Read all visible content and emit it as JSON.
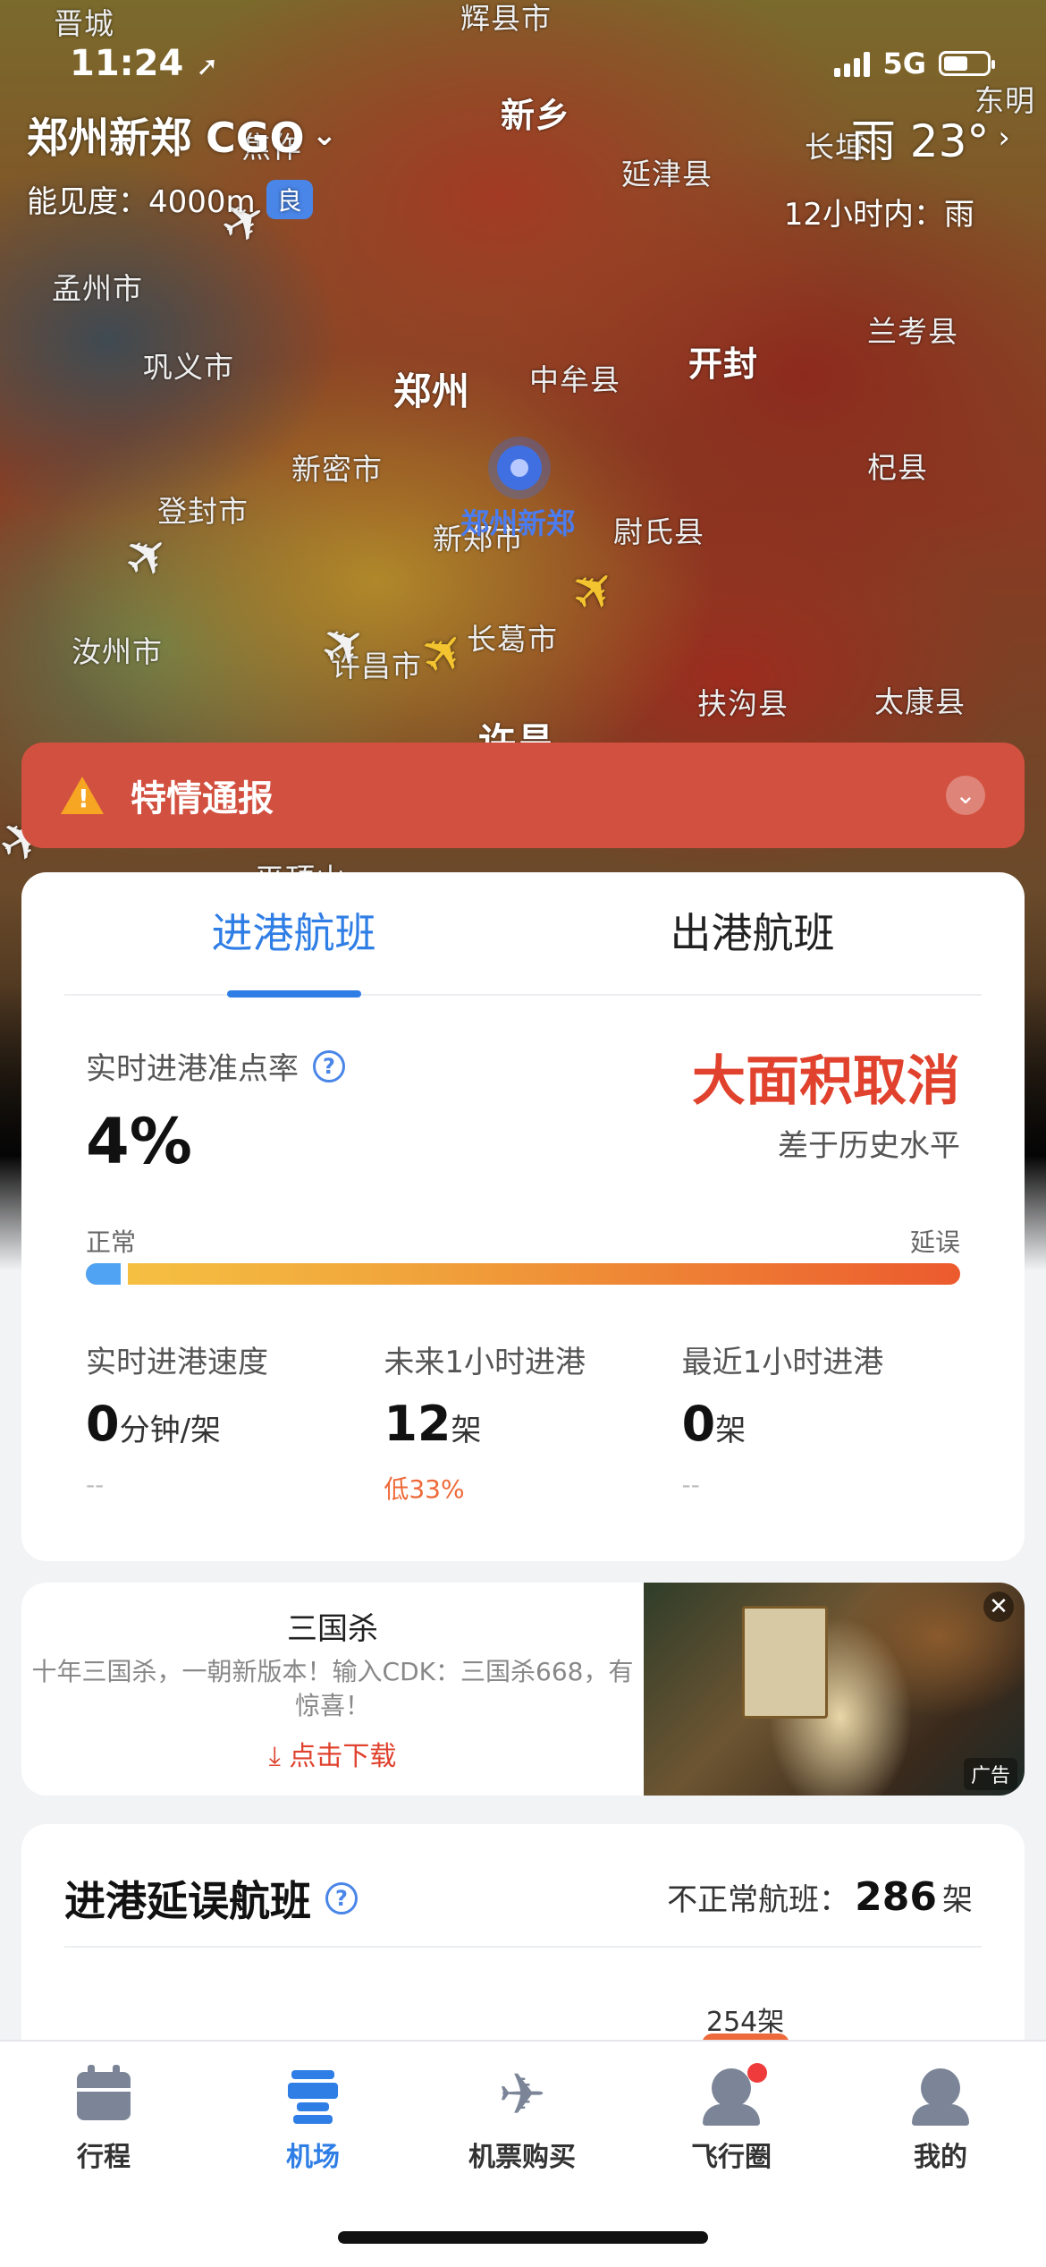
{
  "status_bar": {
    "time": "11:24",
    "network": "5G"
  },
  "header": {
    "airport": "郑州新郑 CGO",
    "visibility_label": "能见度：",
    "visibility_value": "4000m",
    "visibility_badge": "良",
    "weather": "雨 23°",
    "forecast": "12小时内：雨"
  },
  "map": {
    "cities": [
      "晋城",
      "辉县市",
      "新乡",
      "东明",
      "焦作",
      "延津县",
      "长垣",
      "孟州市",
      "巩义市",
      "郑州",
      "中牟县",
      "开封",
      "兰考县",
      "新密市",
      "登封市",
      "新郑市",
      "尉氏县",
      "杞县",
      "汝州市",
      "许昌市",
      "长葛市",
      "扶沟县",
      "太康县",
      "许昌",
      "平顶山"
    ],
    "airport_marker_label": "郑州新郑"
  },
  "alert": {
    "title": "特情通报"
  },
  "flights_card": {
    "tabs": [
      "进港航班",
      "出港航班"
    ],
    "active_tab": 0,
    "ontime_label": "实时进港准点率",
    "ontime_value": "4%",
    "status_text": "大面积取消",
    "history_compare": "差于历史水平",
    "bar_left_label": "正常",
    "bar_right_label": "延误",
    "ontime_fraction": 0.04,
    "stats": [
      {
        "label": "实时进港速度",
        "value": "0",
        "unit": "分钟/架",
        "sub": "--"
      },
      {
        "label": "未来1小时进港",
        "value": "12",
        "unit": "架",
        "sub": "低33%"
      },
      {
        "label": "最近1小时进港",
        "value": "0",
        "unit": "架",
        "sub": "--"
      }
    ]
  },
  "ad": {
    "title": "三国杀",
    "description": "十年三国杀，一朝新版本！输入CDK：三国杀668，有惊喜！",
    "cta": "点击下载",
    "tag": "广告"
  },
  "delay_section": {
    "title": "进港延误航班",
    "abnormal_label": "不正常航班：",
    "abnormal_count": "286",
    "abnormal_unit": "架",
    "bar_label": "254架"
  },
  "tabbar": [
    {
      "label": "行程",
      "icon": "calendar-icon"
    },
    {
      "label": "机场",
      "icon": "control-tower-icon"
    },
    {
      "label": "机票购买",
      "icon": "airplane-icon"
    },
    {
      "label": "飞行圈",
      "icon": "community-icon"
    },
    {
      "label": "我的",
      "icon": "profile-icon"
    }
  ],
  "colors": {
    "accent": "#2f7ee6",
    "alert_bg": "#d2503f",
    "status_red": "#e0422e",
    "orange": "#ee6a3a"
  }
}
